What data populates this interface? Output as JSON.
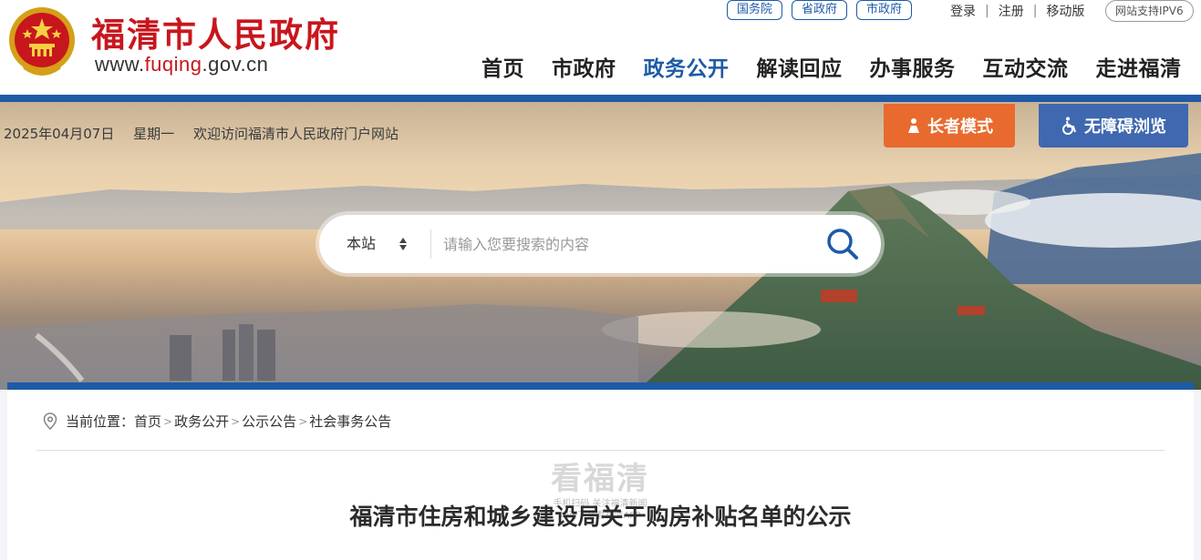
{
  "header": {
    "site_title": "福清市人民政府",
    "url_prefix": "www.",
    "url_accent": "fuqing",
    "url_suffix": ".gov.cn",
    "top_pills": [
      "国务院",
      "省政府",
      "市政府"
    ],
    "user_links": {
      "login": "登录",
      "register": "注册",
      "mobile": "移动版"
    },
    "ipv6_badge": "网站支持IPV6",
    "nav": [
      "首页",
      "市政府",
      "政务公开",
      "解读回应",
      "办事服务",
      "互动交流",
      "走进福清"
    ],
    "active_nav_index": 2,
    "colors": {
      "brand_red": "#c8161d",
      "brand_blue": "#1e5aa6"
    }
  },
  "banner": {
    "date": "2025年04月07日",
    "weekday": "星期一",
    "welcome": "欢迎访问福清市人民政府门户网站",
    "elder_mode": "长者模式",
    "accessibility": "无障碍浏览",
    "colors": {
      "elder": "#e86a2e",
      "accessibility": "#3f68b0"
    }
  },
  "search": {
    "scope": "本站",
    "placeholder": "请输入您要搜索的内容",
    "icon": "search-icon"
  },
  "breadcrumb": {
    "prefix": "当前位置：",
    "items": [
      "首页",
      "政务公开",
      "公示公告",
      "社会事务公告"
    ]
  },
  "article": {
    "title": "福清市住房和城乡建设局关于购房补贴名单的公示"
  },
  "watermark": {
    "brand": "看福清",
    "line1": "手机扫码 关注福清新闻",
    "line2": "均可下载看福清APP"
  }
}
